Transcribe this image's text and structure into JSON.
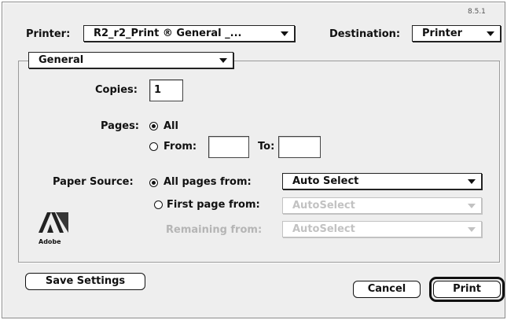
{
  "version": "8.5.1",
  "printer": {
    "label": "Printer:",
    "value": "R2_r2_Print ® General _..."
  },
  "destination": {
    "label": "Destination:",
    "value": "Printer"
  },
  "panel": {
    "value": "General"
  },
  "copies": {
    "label": "Copies:",
    "value": "1"
  },
  "pages": {
    "label": "Pages:",
    "all_label": "All",
    "from_label": "From:",
    "to_label": "To:",
    "from_value": "",
    "to_value": ""
  },
  "paper_source": {
    "label": "Paper Source:",
    "all_pages_label": "All pages from:",
    "all_pages_value": "Auto Select",
    "first_page_label": "First page from:",
    "first_page_value": "AutoSelect",
    "remaining_label": "Remaining from:",
    "remaining_value": "AutoSelect"
  },
  "logo": {
    "name": "adobe-logo",
    "text": "Adobe"
  },
  "buttons": {
    "save_settings": "Save Settings",
    "cancel": "Cancel",
    "print": "Print"
  }
}
